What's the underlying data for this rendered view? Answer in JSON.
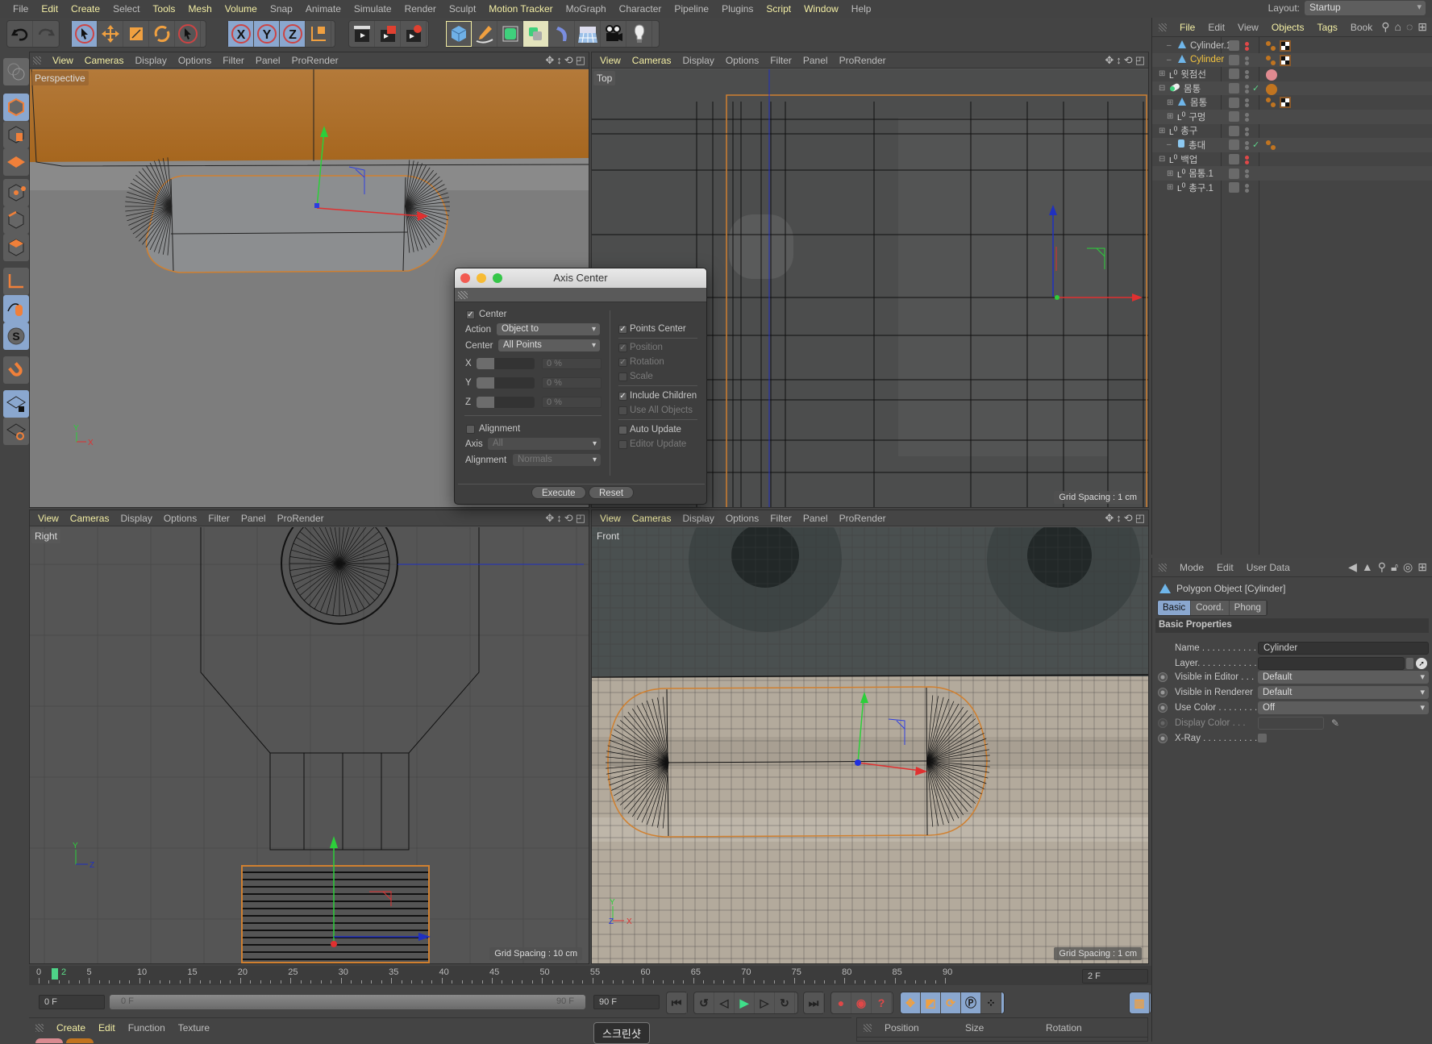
{
  "menubar": {
    "items": [
      {
        "label": "File",
        "hl": false
      },
      {
        "label": "Edit",
        "hl": true
      },
      {
        "label": "Create",
        "hl": true
      },
      {
        "label": "Select",
        "hl": false
      },
      {
        "label": "Tools",
        "hl": true
      },
      {
        "label": "Mesh",
        "hl": true
      },
      {
        "label": "Volume",
        "hl": true
      },
      {
        "label": "Snap",
        "hl": false
      },
      {
        "label": "Animate",
        "hl": false
      },
      {
        "label": "Simulate",
        "hl": false
      },
      {
        "label": "Render",
        "hl": false
      },
      {
        "label": "Sculpt",
        "hl": false
      },
      {
        "label": "Motion Tracker",
        "hl": true
      },
      {
        "label": "MoGraph",
        "hl": false
      },
      {
        "label": "Character",
        "hl": false
      },
      {
        "label": "Pipeline",
        "hl": false
      },
      {
        "label": "Plugins",
        "hl": false
      },
      {
        "label": "Script",
        "hl": true
      },
      {
        "label": "Window",
        "hl": true
      },
      {
        "label": "Help",
        "hl": false
      }
    ],
    "layout_label": "Layout:",
    "layout_value": "Startup"
  },
  "toolbar": {
    "undo": "undo-icon",
    "redo": "redo-icon",
    "tools": [
      "live-selection-icon",
      "move-icon",
      "scale-icon",
      "rotate-icon",
      "recent-tool-icon"
    ],
    "axes": [
      "X",
      "Y",
      "Z"
    ],
    "coord_system": "world-coordinate-icon",
    "render": [
      "render-view-icon",
      "render-picture-viewer-icon",
      "render-settings-icon"
    ],
    "objects": [
      "cube-icon",
      "pen-icon",
      "subdivision-icon",
      "cloner-icon",
      "deformer-icon",
      "floor-icon",
      "camera-icon",
      "light-icon"
    ]
  },
  "left_toolbar": [
    "make-editable-icon",
    "model-mode-icon",
    "texture-mode-icon",
    "workplane-icon",
    "points-mode-icon",
    "edges-mode-icon",
    "polygons-mode-icon",
    "axis-mode-icon",
    "tweak-mode-icon",
    "solo-icon",
    "snap-icon",
    "workplane-lock-icon",
    "workplane-align-icon"
  ],
  "viewport_menu": [
    "View",
    "Cameras",
    "Display",
    "Options",
    "Filter",
    "Panel",
    "ProRender"
  ],
  "viewports": {
    "perspective": {
      "label": "Perspective"
    },
    "top": {
      "label": "Top",
      "grid": "Grid Spacing : 1 cm"
    },
    "right": {
      "label": "Right",
      "grid": "Grid Spacing : 10 cm"
    },
    "front": {
      "label": "Front",
      "grid": "Grid Spacing : 1 cm"
    }
  },
  "object_manager": {
    "menu": [
      {
        "label": "File",
        "hl": true
      },
      {
        "label": "Edit",
        "hl": false
      },
      {
        "label": "View",
        "hl": false
      },
      {
        "label": "Objects",
        "hl": true
      },
      {
        "label": "Tags",
        "hl": true
      },
      {
        "label": "Book",
        "hl": false
      }
    ],
    "objects": [
      {
        "name": "Cylinder.1",
        "type": "polygon",
        "indent": 1,
        "expander": "",
        "selected": false,
        "dot": "red",
        "check": false,
        "tags": [
          "phong",
          "checker"
        ]
      },
      {
        "name": "Cylinder",
        "type": "polygon",
        "indent": 1,
        "expander": "",
        "selected": true,
        "dot": "grey",
        "check": false,
        "tags": [
          "phong",
          "checker"
        ]
      },
      {
        "name": "윗점선",
        "type": "null",
        "indent": 0,
        "expander": "+",
        "selected": false,
        "dot": "grey",
        "check": false,
        "tags": [
          "pink-material"
        ]
      },
      {
        "name": "몸통",
        "type": "capsule",
        "indent": 0,
        "expander": "-",
        "selected": false,
        "dot": "grey",
        "check": true,
        "tags": [
          "orange-material"
        ]
      },
      {
        "name": "몸통",
        "type": "polygon",
        "indent": 1,
        "expander": "+",
        "selected": false,
        "dot": "grey",
        "check": false,
        "tags": [
          "phong",
          "checker"
        ]
      },
      {
        "name": "구멍",
        "type": "null",
        "indent": 1,
        "expander": "+",
        "selected": false,
        "dot": "grey",
        "check": false,
        "tags": []
      },
      {
        "name": "총구",
        "type": "null",
        "indent": 0,
        "expander": "+",
        "selected": false,
        "dot": "grey",
        "check": false,
        "tags": []
      },
      {
        "name": "총대",
        "type": "cylinder",
        "indent": 1,
        "expander": "",
        "selected": false,
        "dot": "grey",
        "check": true,
        "tags": [
          "phong"
        ]
      },
      {
        "name": "백업",
        "type": "null",
        "indent": 0,
        "expander": "-",
        "selected": false,
        "dot": "red",
        "check": false,
        "tags": []
      },
      {
        "name": "몸통.1",
        "type": "null",
        "indent": 1,
        "expander": "+",
        "selected": false,
        "dot": "grey",
        "check": false,
        "tags": []
      },
      {
        "name": "총구.1",
        "type": "null",
        "indent": 1,
        "expander": "+",
        "selected": false,
        "dot": "grey",
        "check": false,
        "tags": []
      }
    ]
  },
  "attribute_manager": {
    "menu": [
      "Mode",
      "Edit",
      "User Data"
    ],
    "title": "Polygon Object [Cylinder]",
    "tabs": [
      {
        "label": "Basic",
        "active": true
      },
      {
        "label": "Coord.",
        "active": false
      },
      {
        "label": "Phong",
        "active": false
      }
    ],
    "section": "Basic Properties",
    "fields": {
      "name_label": "Name . . . . . . . . . . . .",
      "name_value": "Cylinder",
      "layer_label": "Layer. . . . . . . . . . . . .",
      "layer_value": "",
      "vis_editor_label": "Visible in Editor . . .",
      "vis_editor_value": "Default",
      "vis_render_label": "Visible in Renderer",
      "vis_render_value": "Default",
      "use_color_label": "Use Color . . . . . . . .",
      "use_color_value": "Off",
      "display_color_label": "Display Color . . .",
      "xray_label": "X-Ray . . . . . . . . . . . .",
      "xray_checked": false
    }
  },
  "axis_center_dialog": {
    "title": "Axis Center",
    "center_label": "Center",
    "center_checked": true,
    "action_label": "Action",
    "action_value": "Object to",
    "center2_label": "Center",
    "center2_value": "All Points",
    "x_label": "X",
    "x_value": "0 %",
    "x_slider": 0.5,
    "y_label": "Y",
    "y_value": "0 %",
    "y_slider": 0.5,
    "z_label": "Z",
    "z_value": "0 %",
    "z_slider": 0.5,
    "alignment_label": "Alignment",
    "alignment_checked": false,
    "axis_label": "Axis",
    "axis_value": "All",
    "alignment2_label": "Alignment",
    "alignment2_value": "Normals",
    "points_center": "Points Center",
    "points_center_checked": true,
    "position": "Position",
    "position_checked": true,
    "rotation": "Rotation",
    "rotation_checked": true,
    "scale": "Scale",
    "scale_checked": false,
    "include_children": "Include Children",
    "include_children_checked": true,
    "use_all_objects": "Use All Objects",
    "use_all_objects_checked": false,
    "auto_update": "Auto Update",
    "auto_update_checked": false,
    "editor_update": "Editor Update",
    "editor_update_checked": false,
    "execute": "Execute",
    "reset": "Reset"
  },
  "timeline": {
    "min": 0,
    "max": 90,
    "current": 2,
    "labels": [
      "0",
      "2",
      "5",
      "10",
      "15",
      "20",
      "25",
      "30",
      "35",
      "40",
      "45",
      "50",
      "55",
      "60",
      "65",
      "70",
      "75",
      "80",
      "85",
      "90"
    ],
    "current_frame_display": "2 F",
    "start_field": "0 F",
    "range_start": "0 F",
    "range_end": "90 F",
    "end_field": "90 F"
  },
  "material_manager": {
    "menu": [
      {
        "label": "Create",
        "hl": true
      },
      {
        "label": "Edit",
        "hl": true
      },
      {
        "label": "Function",
        "hl": false
      },
      {
        "label": "Texture",
        "hl": false
      }
    ]
  },
  "coordinates_manager": {
    "columns": [
      "Position",
      "Size",
      "Rotation"
    ]
  },
  "tooltip": "스크린샷",
  "colors": {
    "accent_blue": "#8aa7cf",
    "highlight_menu": "#f3eea4",
    "selection": "#f2c33e",
    "orange": "#e8973a",
    "x_axis": "#e03030",
    "y_axis": "#35d045",
    "z_axis": "#3040e0"
  }
}
